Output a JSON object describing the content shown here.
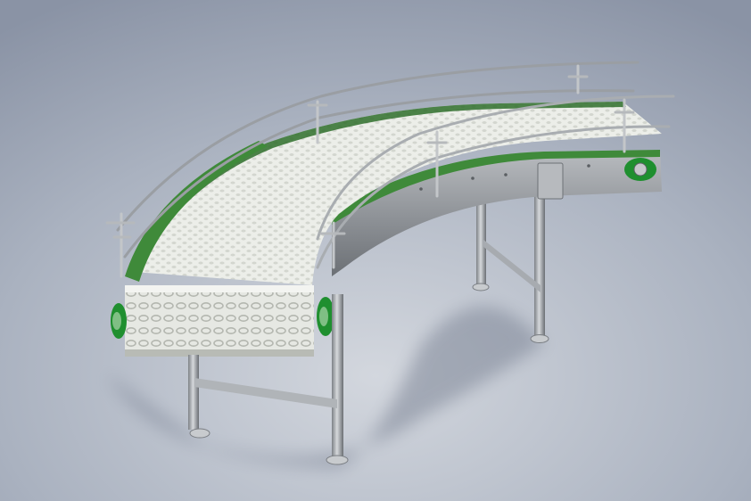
{
  "scene": {
    "subject": "curved-modular-belt-conveyor",
    "colors": {
      "background_top": "#8a93a5",
      "background_bottom": "#cfd3db",
      "stainless": "#9fa3a8",
      "stainless_dark": "#6d7176",
      "stainless_light": "#d9dcdf",
      "wear_strip_green": "#3f8a3a",
      "wear_strip_dark": "#2a5e26",
      "belt": "#eceee9",
      "belt_shadow": "#c9ccc6",
      "bearing_green": "#1f8f2f",
      "shadow": "#7f8797"
    }
  }
}
